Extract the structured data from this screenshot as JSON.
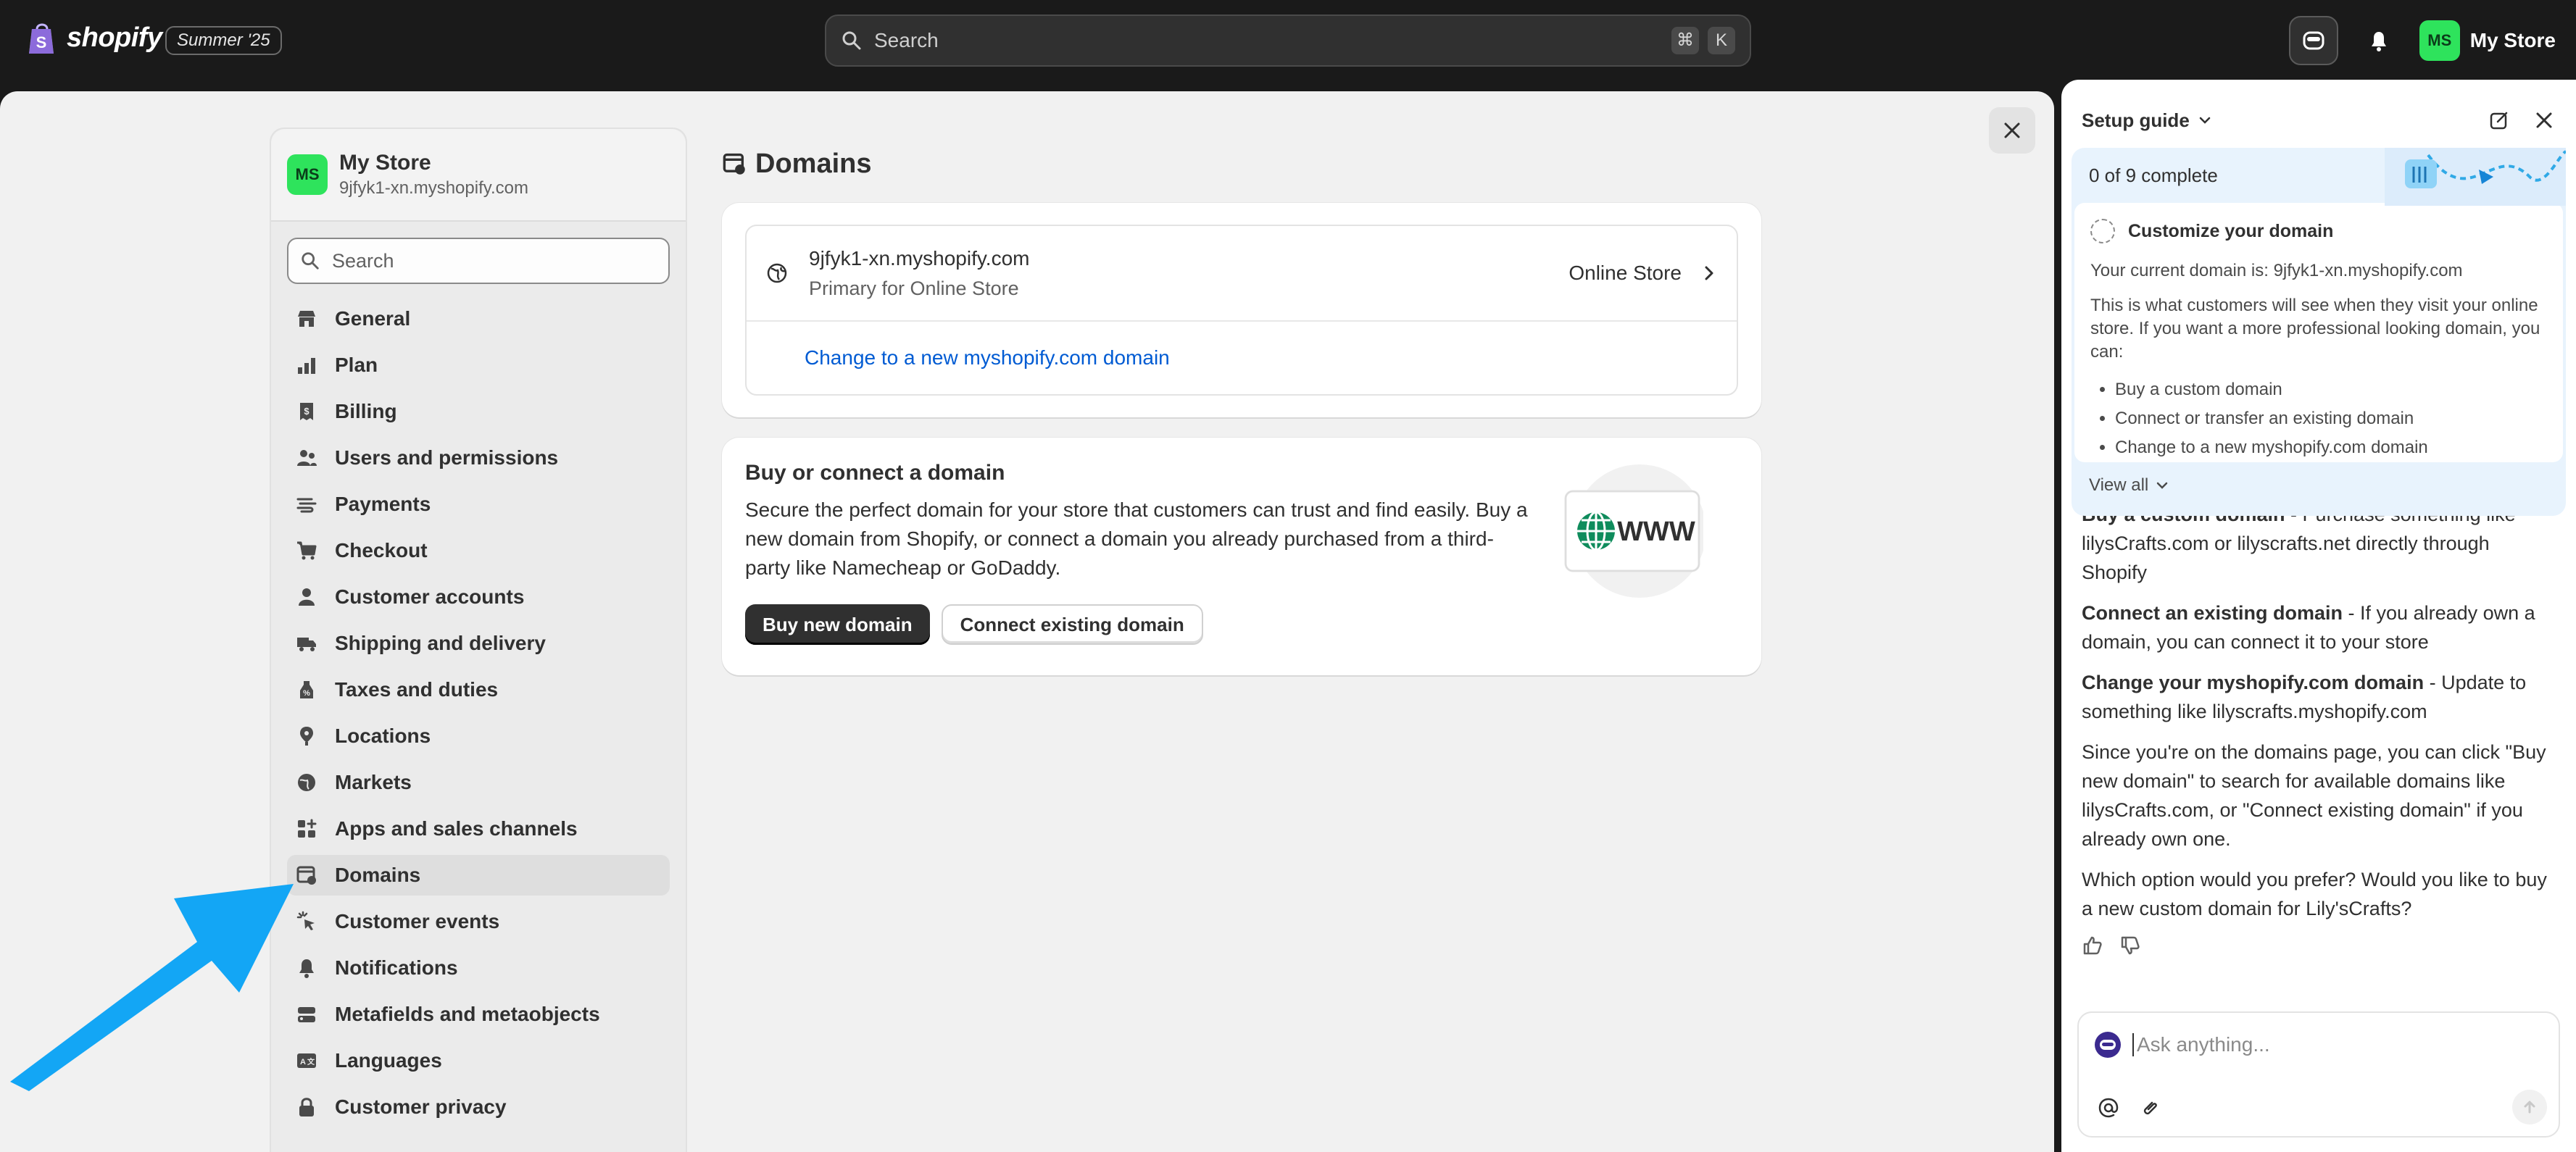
{
  "topbar": {
    "brand": "shopify",
    "edition": "Summer '25",
    "search_placeholder": "Search",
    "shortcut_keys": [
      "⌘",
      "K"
    ],
    "avatar_initials": "MS",
    "store_name": "My Store"
  },
  "settings_nav": {
    "store_name": "My Store",
    "store_url": "9jfyk1-xn.myshopify.com",
    "avatar_initials": "MS",
    "search_placeholder": "Search",
    "items": [
      {
        "label": "General"
      },
      {
        "label": "Plan"
      },
      {
        "label": "Billing"
      },
      {
        "label": "Users and permissions"
      },
      {
        "label": "Payments"
      },
      {
        "label": "Checkout"
      },
      {
        "label": "Customer accounts"
      },
      {
        "label": "Shipping and delivery"
      },
      {
        "label": "Taxes and duties"
      },
      {
        "label": "Locations"
      },
      {
        "label": "Markets"
      },
      {
        "label": "Apps and sales channels"
      },
      {
        "label": "Domains"
      },
      {
        "label": "Customer events"
      },
      {
        "label": "Notifications"
      },
      {
        "label": "Metafields and metaobjects"
      },
      {
        "label": "Languages"
      },
      {
        "label": "Customer privacy"
      }
    ],
    "active_item": "Domains"
  },
  "page": {
    "title": "Domains",
    "domain": {
      "url": "9jfyk1-xn.myshopify.com",
      "subtitle": "Primary for Online Store",
      "channel": "Online Store"
    },
    "change_link": "Change to a new myshopify.com domain",
    "buy_card": {
      "title": "Buy or connect a domain",
      "description": "Secure the perfect domain for your store that customers can trust and find easily. Buy a new domain from Shopify, or connect a domain you already purchased from a third-party like Namecheap or GoDaddy.",
      "primary_button": "Buy new domain",
      "secondary_button": "Connect existing domain",
      "illustration_text": "WWW"
    }
  },
  "setup_guide": {
    "title": "Setup guide",
    "progress": "0 of 9 complete",
    "task_title": "Customize your domain",
    "current_domain_text": "Your current domain is: 9jfyk1-xn.myshopify.com",
    "description": "This is what customers will see when they visit your online store. If you want a more professional looking domain, you can:",
    "options": [
      "Buy a custom domain",
      "Connect or transfer an existing domain",
      "Change to a new myshopify.com domain"
    ],
    "view_all": "View all"
  },
  "chat": {
    "messages": [
      {
        "bold": "Buy a custom domain",
        "text": " - Purchase something like lilysCrafts.com or lilyscrafts.net directly through Shopify"
      },
      {
        "bold": "Connect an existing domain",
        "text": " - If you already own a domain, you can connect it to your store"
      },
      {
        "bold": "Change your myshopify.com domain",
        "text": " - Update to something like lilyscrafts.myshopify.com"
      },
      {
        "bold": "",
        "text": "Since you're on the domains page, you can click \"Buy new domain\" to search for available domains like lilysCrafts.com, or \"Connect existing domain\" if you already own one."
      },
      {
        "bold": "",
        "text": "Which option would you prefer? Would you like to buy a new custom domain for Lily'sCrafts?"
      }
    ],
    "input_placeholder": "Ask anything..."
  },
  "colors": {
    "accent_green": "#2ee35c",
    "link_blue": "#005bd3",
    "annotation_arrow": "#13a6f5",
    "guide_bg": "#e8f3fd"
  }
}
